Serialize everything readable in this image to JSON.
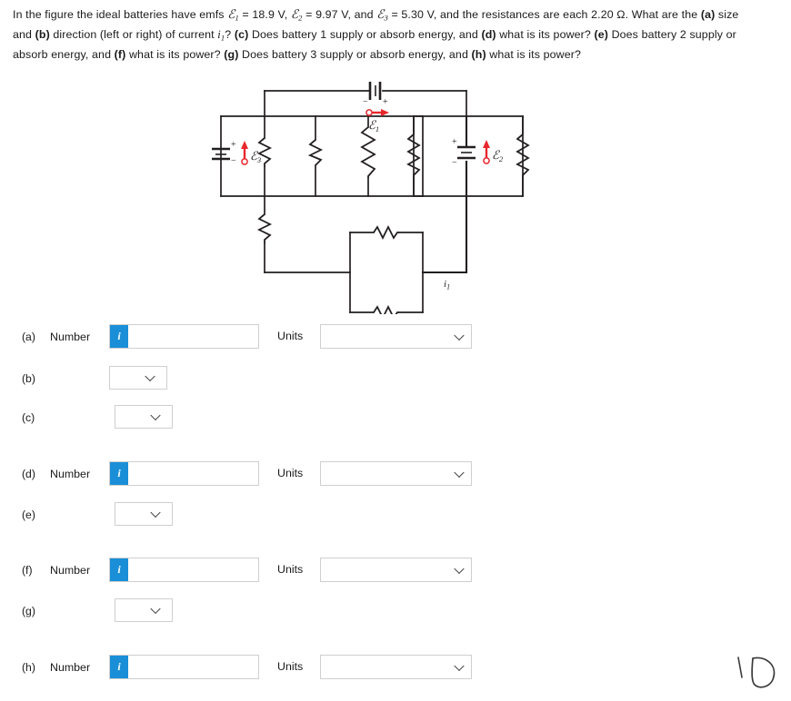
{
  "problem": {
    "line1_a": "In the figure the ideal batteries have emfs ",
    "emf1": "ℰ",
    "emf1_sub": "1",
    "emf1_val": " = 18.9 V, ",
    "emf2": "ℰ",
    "emf2_sub": "2",
    "emf2_val": " = 9.97 V, and ",
    "emf3": "ℰ",
    "emf3_sub": "3",
    "emf3_val": " = 5.30 V, and the resistances are each 2.20 Ω. What are the ",
    "part_a": "(a)",
    "text_a": " size and ",
    "part_b": "(b)",
    "text_b": " direction (left or right) of current ",
    "current_sym": "i",
    "current_sub": "1",
    "text_b2": "? ",
    "part_c": "(c)",
    "text_c": " Does battery 1 supply or absorb energy, and ",
    "part_d": "(d)",
    "text_d": " what is its power? ",
    "part_e": "(e)",
    "text_e": " Does battery 2 supply or absorb energy, and ",
    "part_f": "(f)",
    "text_f": " what is its power? ",
    "part_g": "(g)",
    "text_g": " Does battery 3 supply or absorb energy, and ",
    "part_h": "(h)",
    "text_h": " what is its power?"
  },
  "figure": {
    "label_emf1": "ℰ",
    "label_emf1_sub": "1",
    "label_emf2": "ℰ",
    "label_emf2_sub": "2",
    "label_emf3": "ℰ",
    "label_emf3_sub": "3",
    "label_current": "i",
    "label_current_sub": "1",
    "battery1_minus": "−",
    "battery1_plus": "+",
    "battery2_plus": "+",
    "battery2_minus": "−",
    "battery3_plus": "+",
    "battery3_minus": "−",
    "wire_color": "#231f20",
    "emf_arrow_color": "#e8272c"
  },
  "colors": {
    "info_badge": "#1a8fd8",
    "field_border": "#cfcfcf",
    "text": "#1a1a1a"
  },
  "rows": [
    {
      "tag": "(a)",
      "type": "number",
      "number_label": "Number",
      "value": "",
      "placeholder": "",
      "info": "i",
      "units_label": "Units",
      "units_value": ""
    },
    {
      "tag": "(b)",
      "type": "select",
      "value": ""
    },
    {
      "tag": "(c)",
      "type": "select",
      "value": ""
    },
    {
      "tag": "(d)",
      "type": "number",
      "number_label": "Number",
      "value": "",
      "placeholder": "",
      "info": "i",
      "units_label": "Units",
      "units_value": ""
    },
    {
      "tag": "(e)",
      "type": "select",
      "value": ""
    },
    {
      "tag": "(f)",
      "type": "number",
      "number_label": "Number",
      "value": "",
      "placeholder": "",
      "info": "i",
      "units_label": "Units",
      "units_value": ""
    },
    {
      "tag": "(g)",
      "type": "select",
      "value": ""
    },
    {
      "tag": "(h)",
      "type": "number",
      "number_label": "Number",
      "value": "",
      "placeholder": "",
      "info": "i",
      "units_label": "Units",
      "units_value": ""
    }
  ]
}
